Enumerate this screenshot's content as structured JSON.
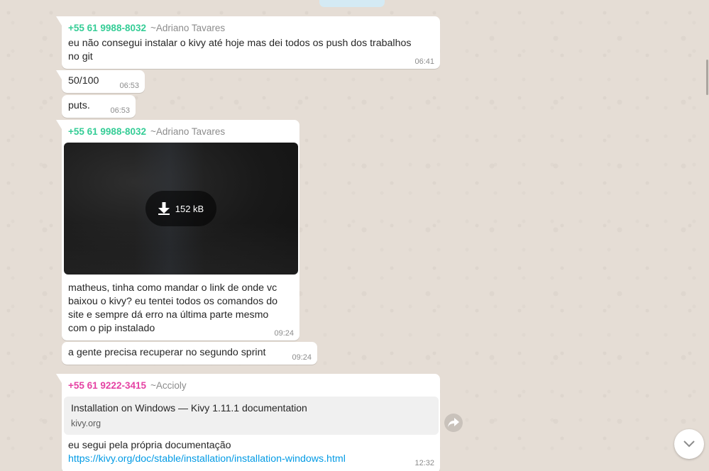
{
  "colors": {
    "chat_background": "#e5ddd5",
    "bubble": "#ffffff",
    "sender_adriano": "#35cd96",
    "sender_accioly": "#e542a3",
    "link": "#039be5"
  },
  "messages": [
    {
      "sender_phone": "+55 61 9988-8032",
      "sender_alias": "~Adriano Tavares",
      "lines": [
        "eu não consegui instalar o kivy até hoje mas dei todos os push dos trabalhos",
        "no git"
      ],
      "time": "06:41"
    },
    {
      "text": "50/100",
      "time": "06:53"
    },
    {
      "text": "puts.",
      "time": "06:53"
    },
    {
      "sender_phone": "+55 61 9988-8032",
      "sender_alias": "~Adriano Tavares",
      "media": {
        "download_size": "152 kB",
        "icon": "download-arrow-icon"
      },
      "lines": [
        "matheus, tinha como mandar o link de onde vc",
        "baixou o kivy? eu tentei todos os comandos do",
        "site e sempre dá erro na última parte mesmo",
        "com o pip instalado"
      ],
      "time": "09:24"
    },
    {
      "text": "a gente precisa recuperar no segundo sprint",
      "time": "09:24"
    },
    {
      "sender_phone": "+55 61 9222-3415",
      "sender_alias": "~Accioly",
      "link_preview": {
        "title": "Installation on Windows — Kivy 1.11.1 documentation",
        "domain": "kivy.org"
      },
      "text": "eu segui pela própria documentação",
      "url": "https://kivy.org/doc/stable/installation/installation-windows.html",
      "time": "12:32"
    }
  ],
  "icons": {
    "forward": "forward-arrow-icon",
    "scroll_down": "chevron-down-icon"
  }
}
